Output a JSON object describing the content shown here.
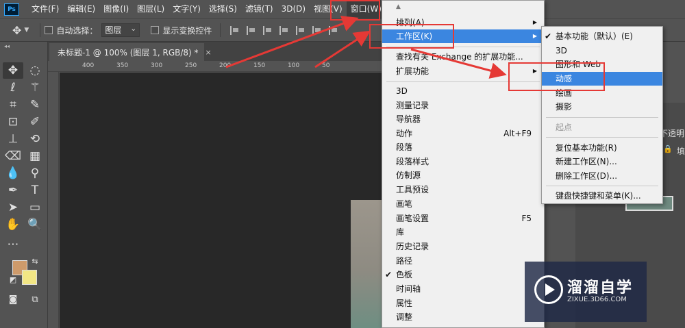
{
  "app": {
    "logo": "Ps"
  },
  "menubar": {
    "items": [
      "文件(F)",
      "编辑(E)",
      "图像(I)",
      "图层(L)",
      "文字(Y)",
      "选择(S)",
      "滤镜(T)",
      "3D(D)",
      "视图(V)",
      "窗口(W)"
    ]
  },
  "options": {
    "auto_select_label": "自动选择：",
    "auto_select_value": "图层",
    "show_transform_label": "显示变换控件"
  },
  "document_tab": {
    "title": "未标题-1 @ 100% (图层 1, RGB/8) *",
    "close": "×"
  },
  "ruler": {
    "ticks": [
      "400",
      "350",
      "300",
      "250",
      "200",
      "150",
      "100",
      "50"
    ]
  },
  "window_menu": {
    "items": [
      {
        "label": "排列(A)",
        "submenu": true
      },
      {
        "label": "工作区(K)",
        "submenu": true,
        "highlighted": true
      },
      {
        "label": "查找有关 Exchange 的扩展功能..."
      },
      {
        "label": "扩展功能",
        "submenu": true
      },
      {
        "label": "3D"
      },
      {
        "label": "测量记录"
      },
      {
        "label": "导航器"
      },
      {
        "label": "动作",
        "shortcut": "Alt+F9"
      },
      {
        "label": "段落"
      },
      {
        "label": "段落样式"
      },
      {
        "label": "仿制源"
      },
      {
        "label": "工具预设"
      },
      {
        "label": "画笔"
      },
      {
        "label": "画笔设置",
        "shortcut": "F5"
      },
      {
        "label": "库"
      },
      {
        "label": "历史记录"
      },
      {
        "label": "路径"
      },
      {
        "label": "色板",
        "checked": true
      },
      {
        "label": "时间轴"
      },
      {
        "label": "属性"
      },
      {
        "label": "调整"
      }
    ]
  },
  "workspace_submenu": {
    "items": [
      {
        "label": "基本功能（默认）(E)",
        "checked": true
      },
      {
        "label": "3D"
      },
      {
        "label": "图形和 Web"
      },
      {
        "label": "动感",
        "highlighted": true
      },
      {
        "label": "绘画"
      },
      {
        "label": "摄影"
      },
      {
        "label": "起点",
        "disabled": true
      },
      {
        "label": "复位基本功能(R)"
      },
      {
        "label": "新建工作区(N)..."
      },
      {
        "label": "删除工作区(D)..."
      },
      {
        "label": "键盘快捷键和菜单(K)..."
      }
    ]
  },
  "right_panel": {
    "opacity_label": "不透明",
    "fill_label": "填"
  },
  "watermark": {
    "title": "溜溜自学",
    "url": "ZIXUE.3D66.COM"
  },
  "colors": {
    "foreground": "#cd9a6b",
    "background": "#f2e684",
    "highlight": "#3b86e0",
    "annotation": "#e53935"
  }
}
